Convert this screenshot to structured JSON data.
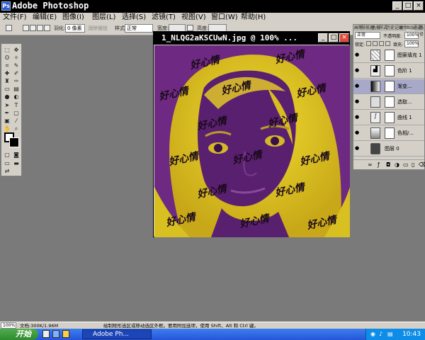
{
  "app": {
    "title": "Adobe Photoshop"
  },
  "menu": [
    "文件(F)",
    "编辑(E)",
    "图像(I)",
    "图层(L)",
    "选择(S)",
    "滤镜(T)",
    "视图(V)",
    "窗口(W)",
    "帮助(H)"
  ],
  "options": {
    "feather_label": "羽化:",
    "feather_value": "0 像素",
    "antialias_label": "消除锯齿",
    "style_label": "样式:",
    "style_value": "正常",
    "width_label": "宽度:",
    "height_label": "高度:"
  },
  "document": {
    "title": "1_NLQG2aKSCUwN.jpg @ 100% ...",
    "watermark": "好心情"
  },
  "panel": {
    "tabs": [
      "画笔",
      "导航器",
      "色板",
      "样式",
      "历史记录",
      "动作",
      "图层",
      "通道",
      "路径"
    ],
    "blend_mode": "正常",
    "opacity_label": "不透明度:",
    "opacity_value": "100%",
    "lock_label": "锁定:",
    "fill_label": "填充:",
    "fill_value": "100%",
    "layers": [
      {
        "name": "图案填充 1",
        "selected": false
      },
      {
        "name": "色阶 1",
        "selected": false
      },
      {
        "name": "渐变...",
        "selected": true
      },
      {
        "name": "选取...",
        "selected": false
      },
      {
        "name": "曲线 1",
        "selected": false
      },
      {
        "name": "色相/...",
        "selected": false
      },
      {
        "name": "图层 0",
        "selected": false
      }
    ]
  },
  "status": {
    "zoom": "100%",
    "doc_size": "文档:300K/1.96M",
    "hint": "绘制矩形选区或移动选区外框。要用附加选项，使用 Shift、Alt 和 Ctrl 键。"
  },
  "taskbar": {
    "start_label": "开始",
    "task_label": "Adobe Ph...",
    "clock": "10:43"
  },
  "colors": {
    "canvas_purple": "#6e2a82",
    "canvas_yellow": "#e8d020",
    "titlebar": "#000000"
  }
}
